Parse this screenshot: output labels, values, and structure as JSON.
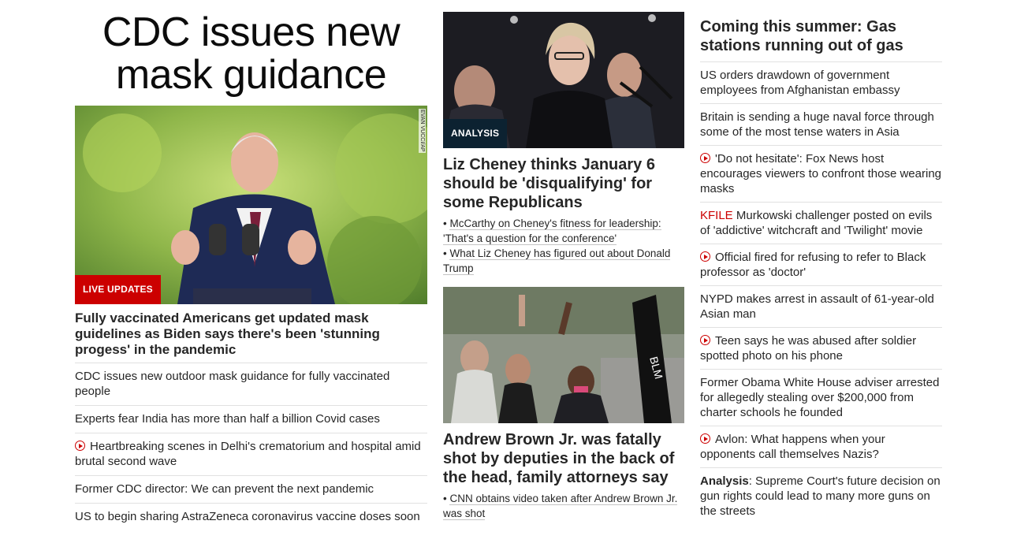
{
  "col1": {
    "headline": "CDC issues new mask guidance",
    "badge": "LIVE UPDATES",
    "photo_credit": "EVAN VUCCI/AP",
    "lead_title": "Fully vaccinated Americans get updated mask guidelines as Biden says there's been 'stunning progess' in the pandemic",
    "links": [
      {
        "text": "CDC issues new outdoor mask guidance for fully vaccinated people",
        "video": false
      },
      {
        "text": "Experts fear India has more than half a billion Covid cases",
        "video": false
      },
      {
        "text": "Heartbreaking scenes in Delhi's crematorium and hospital amid brutal second wave",
        "video": true
      },
      {
        "text": "Former CDC director: We can prevent the next pandemic",
        "video": false
      },
      {
        "text": "US to begin sharing AstraZeneca coronavirus vaccine doses soon",
        "video": false
      }
    ]
  },
  "col2": {
    "story1": {
      "badge": "ANALYSIS",
      "title": "Liz Cheney thinks January 6 should be 'disqualifying' for some Republicans",
      "subs": [
        "McCarthy on Cheney's fitness for leadership: 'That's a question for the conference'",
        "What Liz Cheney has figured out about Donald Trump"
      ]
    },
    "story2": {
      "title": "Andrew Brown Jr. was fatally shot by deputies in the back of the head, family attorneys say",
      "subs": [
        "CNN obtains video taken after Andrew Brown Jr. was shot"
      ]
    }
  },
  "col3": {
    "title": "Coming this summer: Gas stations running out of gas",
    "links": [
      {
        "prefix": "",
        "text": "US orders drawdown of government employees from Afghanistan embassy",
        "video": false
      },
      {
        "prefix": "",
        "text": "Britain is sending a huge naval force through some of the most tense waters in Asia",
        "video": false
      },
      {
        "prefix": "",
        "text": "'Do not hesitate': Fox News host encourages viewers to confront those wearing masks",
        "video": true
      },
      {
        "prefix": "KFILE",
        "text": " Murkowski challenger posted on evils of 'addictive' witchcraft and 'Twilight' movie",
        "video": false
      },
      {
        "prefix": "",
        "text": "Official fired for refusing to refer to Black professor as 'doctor'",
        "video": true
      },
      {
        "prefix": "",
        "text": "NYPD makes arrest in assault of 61-year-old Asian man",
        "video": false
      },
      {
        "prefix": "",
        "text": "Teen says he was abused after soldier spotted photo on his phone",
        "video": true
      },
      {
        "prefix": "",
        "text": "Former Obama White House adviser arrested for allegedly stealing over $200,000 from charter schools he founded",
        "video": false
      },
      {
        "prefix": "",
        "text": "Avlon: What happens when your opponents call themselves Nazis?",
        "video": true
      },
      {
        "bold_prefix": "Analysis",
        "text": ": Supreme Court's future decision on gun rights could lead to many more guns on the streets",
        "video": false
      }
    ]
  },
  "colors": {
    "accent": "#cc0000",
    "analysis_badge": "#0c2231",
    "text": "#262626"
  }
}
